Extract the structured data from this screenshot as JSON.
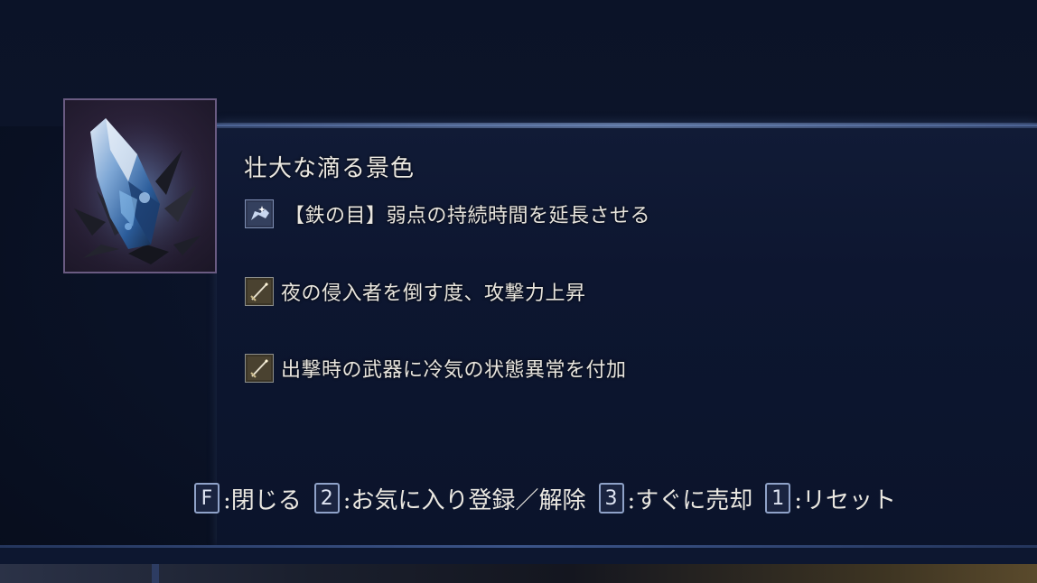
{
  "item": {
    "name": "壮大な滴る景色",
    "icon": "blue-crystal-relic-icon"
  },
  "effects": [
    {
      "icon": "iron-eye-skill-icon",
      "text": "【鉄の目】弱点の持続時間を延長させる"
    },
    {
      "icon": "sword-icon",
      "text": "夜の侵入者を倒す度、攻撃力上昇"
    },
    {
      "icon": "sword-icon",
      "text": "出撃時の武器に冷気の状態異常を付加"
    }
  ],
  "hints": [
    {
      "key": "F",
      "label": ":閉じる"
    },
    {
      "key": "2",
      "label": ":お気に入り登録／解除"
    },
    {
      "key": "3",
      "label": ":すぐに売却"
    },
    {
      "key": "1",
      "label": ":リセット"
    }
  ],
  "colors": {
    "background": "#0a1226",
    "panel": "#0d1630",
    "frame_border": "#6a5b82",
    "key_border": "#8fa2c8",
    "text": "#ece9e2"
  }
}
